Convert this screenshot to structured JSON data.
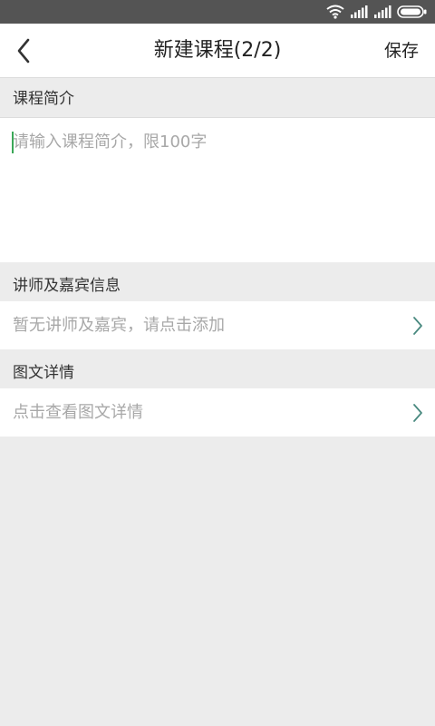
{
  "status_bar": {
    "icons": [
      "wifi-icon",
      "signal-icon",
      "signal-icon",
      "battery-icon"
    ]
  },
  "header": {
    "back_icon": "chevron-left-icon",
    "title": "新建课程(2/2)",
    "save_label": "保存"
  },
  "intro_section": {
    "label": "课程简介",
    "placeholder": "请输入课程简介，限100字",
    "value": ""
  },
  "lecturer_section": {
    "label": "讲师及嘉宾信息",
    "row_text": "暂无讲师及嘉宾，请点击添加",
    "row_icon": "chevron-right-icon"
  },
  "detail_section": {
    "label": "图文详情",
    "row_text": "点击查看图文详情",
    "row_icon": "chevron-right-icon"
  },
  "colors": {
    "accent_caret": "#3aa757",
    "chevron": "#4a8a80",
    "background": "#ececec",
    "status_bar": "#545454"
  }
}
